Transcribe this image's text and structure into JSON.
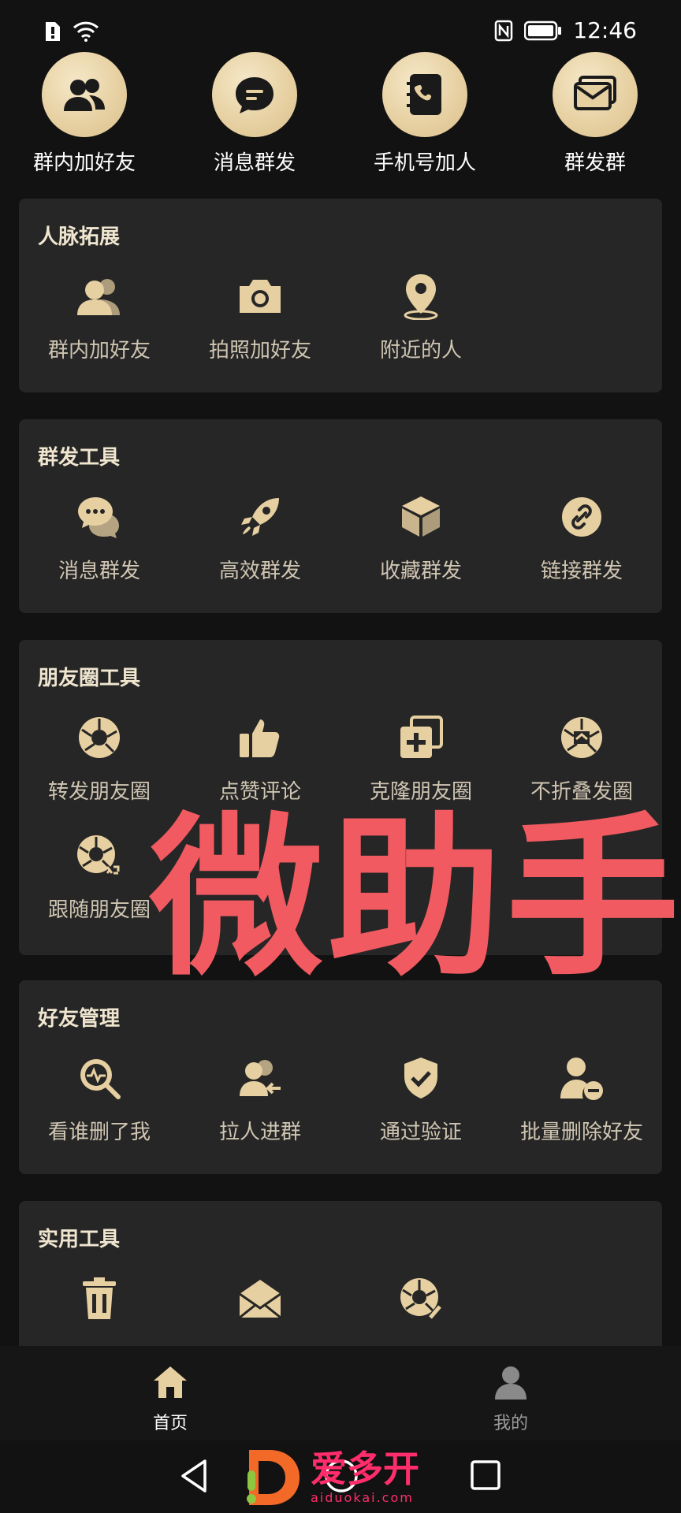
{
  "status": {
    "time": "12:46"
  },
  "colors": {
    "accent": "#e6cfa0",
    "card_bg": "#262626",
    "page_bg": "#121212",
    "watermark": "#f05a60"
  },
  "quick": [
    {
      "label": "群内加好友",
      "icon": "people-icon"
    },
    {
      "label": "消息群发",
      "icon": "chat-bubble-icon"
    },
    {
      "label": "手机号加人",
      "icon": "phone-book-icon"
    },
    {
      "label": "群发群",
      "icon": "mail-stack-icon"
    }
  ],
  "sections": {
    "network": {
      "title": "人脉拓展",
      "items": [
        "群内加好友",
        "拍照加好友",
        "附近的人"
      ]
    },
    "broadcast": {
      "title": "群发工具",
      "items": [
        "消息群发",
        "高效群发",
        "收藏群发",
        "链接群发"
      ]
    },
    "moments": {
      "title": "朋友圈工具",
      "items": [
        "转发朋友圈",
        "点赞评论",
        "克隆朋友圈",
        "不折叠发圈",
        "跟随朋友圈"
      ]
    },
    "friends": {
      "title": "好友管理",
      "items": [
        "看谁删了我",
        "拉人进群",
        "通过验证",
        "批量删除好友"
      ]
    },
    "utility": {
      "title": "实用工具"
    }
  },
  "watermark": "微助手",
  "tabs": [
    {
      "label": "首页",
      "icon": "home-icon"
    },
    {
      "label": "我的",
      "icon": "user-icon"
    }
  ],
  "logo": {
    "text": "爱多开",
    "domain": "aiduokai.com"
  }
}
